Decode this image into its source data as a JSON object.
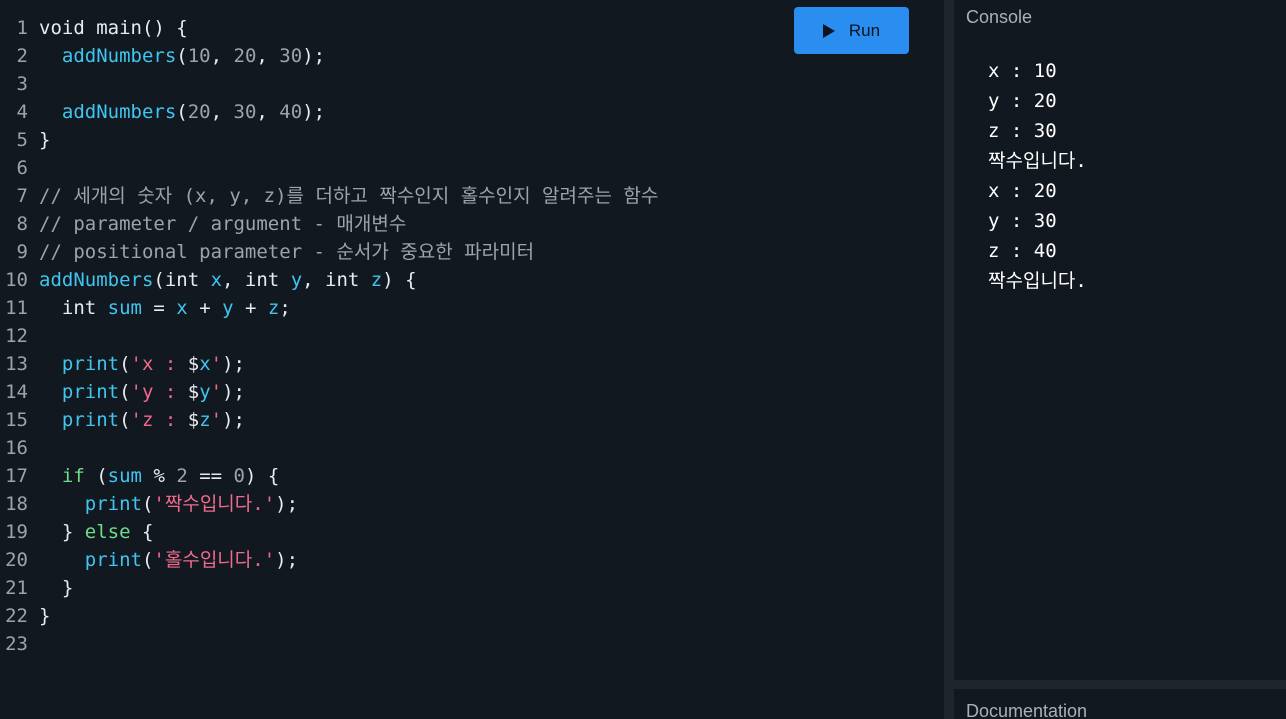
{
  "toolbar": {
    "run_label": "Run",
    "run_icon": "play-icon"
  },
  "editor": {
    "lines": [
      {
        "n": "1",
        "tokens": [
          [
            "plain",
            "void main() {"
          ]
        ]
      },
      {
        "n": "2",
        "tokens": [
          [
            "plain",
            "  "
          ],
          [
            "fn",
            "addNumbers"
          ],
          [
            "plain",
            "("
          ],
          [
            "num",
            "10"
          ],
          [
            "plain",
            ", "
          ],
          [
            "num",
            "20"
          ],
          [
            "plain",
            ", "
          ],
          [
            "num",
            "30"
          ],
          [
            "plain",
            ");"
          ]
        ]
      },
      {
        "n": "3",
        "tokens": []
      },
      {
        "n": "4",
        "tokens": [
          [
            "plain",
            "  "
          ],
          [
            "fn",
            "addNumbers"
          ],
          [
            "plain",
            "("
          ],
          [
            "num",
            "20"
          ],
          [
            "plain",
            ", "
          ],
          [
            "num",
            "30"
          ],
          [
            "plain",
            ", "
          ],
          [
            "num",
            "40"
          ],
          [
            "plain",
            ");"
          ]
        ]
      },
      {
        "n": "5",
        "tokens": [
          [
            "plain",
            "}"
          ]
        ]
      },
      {
        "n": "6",
        "tokens": []
      },
      {
        "n": "7",
        "tokens": [
          [
            "comment",
            "// 세개의 숫자 (x, y, z)를 더하고 짝수인지 홀수인지 알려주는 함수"
          ]
        ]
      },
      {
        "n": "8",
        "tokens": [
          [
            "comment",
            "// parameter / argument - 매개변수"
          ]
        ]
      },
      {
        "n": "9",
        "tokens": [
          [
            "comment",
            "// positional parameter - 순서가 중요한 파라미터"
          ]
        ]
      },
      {
        "n": "10",
        "tokens": [
          [
            "fn",
            "addNumbers"
          ],
          [
            "plain",
            "(int "
          ],
          [
            "var",
            "x"
          ],
          [
            "plain",
            ", int "
          ],
          [
            "var",
            "y"
          ],
          [
            "plain",
            ", int "
          ],
          [
            "var",
            "z"
          ],
          [
            "plain",
            ") {"
          ]
        ]
      },
      {
        "n": "11",
        "tokens": [
          [
            "plain",
            "  int "
          ],
          [
            "var",
            "sum"
          ],
          [
            "plain",
            " = "
          ],
          [
            "var",
            "x"
          ],
          [
            "plain",
            " + "
          ],
          [
            "var",
            "y"
          ],
          [
            "plain",
            " + "
          ],
          [
            "var",
            "z"
          ],
          [
            "plain",
            ";"
          ]
        ]
      },
      {
        "n": "12",
        "tokens": []
      },
      {
        "n": "13",
        "tokens": [
          [
            "plain",
            "  "
          ],
          [
            "fn",
            "print"
          ],
          [
            "plain",
            "("
          ],
          [
            "str",
            "'x : "
          ],
          [
            "plain",
            "$"
          ],
          [
            "var",
            "x"
          ],
          [
            "str",
            "'"
          ],
          [
            "plain",
            ");"
          ]
        ]
      },
      {
        "n": "14",
        "tokens": [
          [
            "plain",
            "  "
          ],
          [
            "fn",
            "print"
          ],
          [
            "plain",
            "("
          ],
          [
            "str",
            "'y : "
          ],
          [
            "plain",
            "$"
          ],
          [
            "var",
            "y"
          ],
          [
            "str",
            "'"
          ],
          [
            "plain",
            ");"
          ]
        ]
      },
      {
        "n": "15",
        "tokens": [
          [
            "plain",
            "  "
          ],
          [
            "fn",
            "print"
          ],
          [
            "plain",
            "("
          ],
          [
            "str",
            "'z : "
          ],
          [
            "plain",
            "$"
          ],
          [
            "var",
            "z"
          ],
          [
            "str",
            "'"
          ],
          [
            "plain",
            ");"
          ]
        ]
      },
      {
        "n": "16",
        "tokens": []
      },
      {
        "n": "17",
        "tokens": [
          [
            "plain",
            "  "
          ],
          [
            "kw",
            "if"
          ],
          [
            "plain",
            " ("
          ],
          [
            "var",
            "sum"
          ],
          [
            "plain",
            " % "
          ],
          [
            "num",
            "2"
          ],
          [
            "plain",
            " == "
          ],
          [
            "num",
            "0"
          ],
          [
            "plain",
            ") {"
          ]
        ]
      },
      {
        "n": "18",
        "tokens": [
          [
            "plain",
            "    "
          ],
          [
            "fn",
            "print"
          ],
          [
            "plain",
            "("
          ],
          [
            "str",
            "'짝수입니다.'"
          ],
          [
            "plain",
            ");"
          ]
        ]
      },
      {
        "n": "19",
        "tokens": [
          [
            "plain",
            "  } "
          ],
          [
            "kw",
            "else"
          ],
          [
            "plain",
            " {"
          ]
        ]
      },
      {
        "n": "20",
        "tokens": [
          [
            "plain",
            "    "
          ],
          [
            "fn",
            "print"
          ],
          [
            "plain",
            "("
          ],
          [
            "str",
            "'홀수입니다.'"
          ],
          [
            "plain",
            ");"
          ]
        ]
      },
      {
        "n": "21",
        "tokens": [
          [
            "plain",
            "  }"
          ]
        ]
      },
      {
        "n": "22",
        "tokens": [
          [
            "plain",
            "}"
          ]
        ]
      },
      {
        "n": "23",
        "tokens": []
      }
    ]
  },
  "console": {
    "title": "Console",
    "output": [
      "x : 10",
      "y : 20",
      "z : 30",
      "짝수입니다.",
      "x : 20",
      "y : 30",
      "z : 40",
      "짝수입니다."
    ]
  },
  "docs": {
    "title": "Documentation"
  },
  "colors": {
    "background": "#121820",
    "run_button": "#2a8df0",
    "function": "#3fc5f0",
    "string": "#f06a8e",
    "keyword": "#6edc8a",
    "number_comment": "#9ba3ad"
  }
}
